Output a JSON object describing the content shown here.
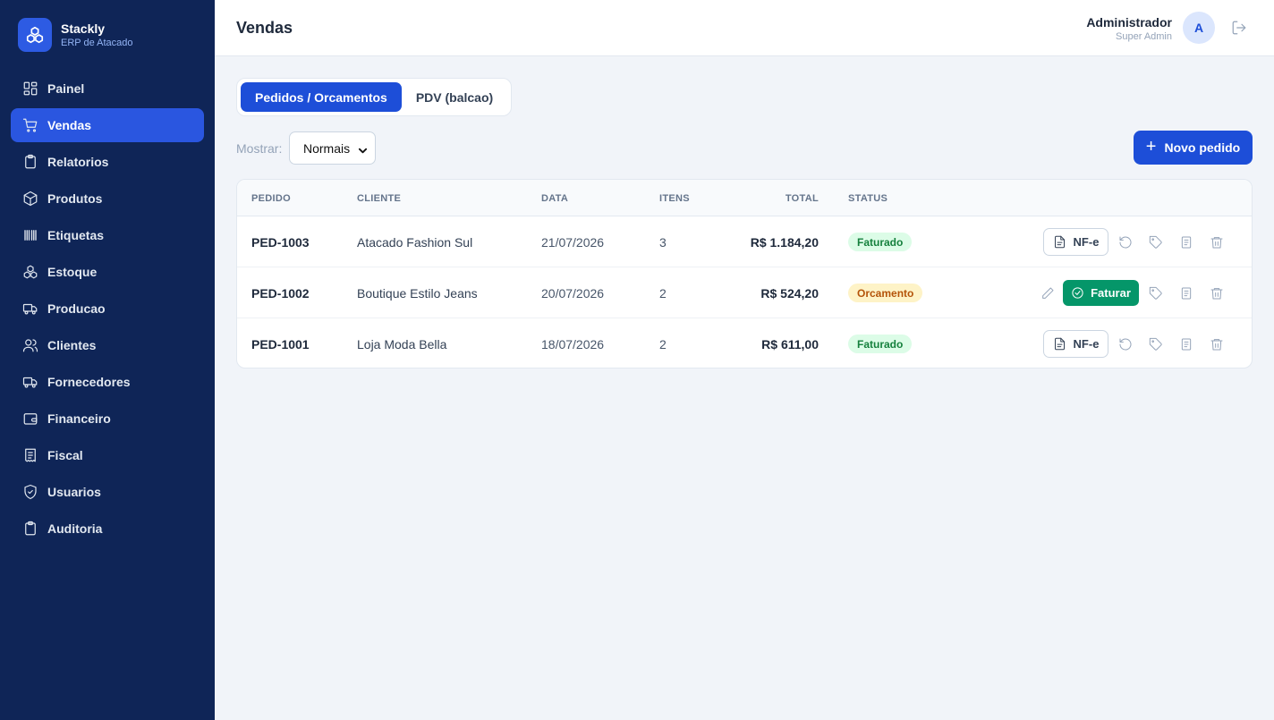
{
  "brand": {
    "name": "Stackly",
    "subtitle": "ERP de Atacado",
    "color": "#2d5be3"
  },
  "sidebar": {
    "items": [
      {
        "label": "Painel",
        "icon": "dashboard-icon"
      },
      {
        "label": "Vendas",
        "icon": "cart-icon",
        "active": true
      },
      {
        "label": "Relatorios",
        "icon": "clipboard-icon"
      },
      {
        "label": "Produtos",
        "icon": "box-icon"
      },
      {
        "label": "Etiquetas",
        "icon": "barcode-icon"
      },
      {
        "label": "Estoque",
        "icon": "boxes-icon"
      },
      {
        "label": "Producao",
        "icon": "truck-icon"
      },
      {
        "label": "Clientes",
        "icon": "users-icon"
      },
      {
        "label": "Fornecedores",
        "icon": "truck-icon"
      },
      {
        "label": "Financeiro",
        "icon": "wallet-icon"
      },
      {
        "label": "Fiscal",
        "icon": "receipt-icon"
      },
      {
        "label": "Usuarios",
        "icon": "shield-icon"
      },
      {
        "label": "Auditoria",
        "icon": "clipboard-icon"
      }
    ]
  },
  "header": {
    "title": "Vendas",
    "user_name": "Administrador",
    "user_role": "Super Admin",
    "avatar_initial": "A"
  },
  "tabs": [
    {
      "label": "Pedidos / Orcamentos",
      "active": true
    },
    {
      "label": "PDV (balcao)",
      "active": false
    }
  ],
  "filter": {
    "label": "Mostrar:",
    "value": "Normais"
  },
  "new_button": {
    "label": "Novo pedido"
  },
  "table": {
    "columns": [
      "PEDIDO",
      "CLIENTE",
      "DATA",
      "ITENS",
      "TOTAL",
      "STATUS"
    ],
    "rows": [
      {
        "id": "PED-1003",
        "cliente": "Atacado Fashion Sul",
        "data": "21/07/2026",
        "itens": "3",
        "total": "R$ 1.184,20",
        "status": "Faturado",
        "status_type": "faturado"
      },
      {
        "id": "PED-1002",
        "cliente": "Boutique Estilo Jeans",
        "data": "20/07/2026",
        "itens": "2",
        "total": "R$ 524,20",
        "status": "Orcamento",
        "status_type": "orcamento"
      },
      {
        "id": "PED-1001",
        "cliente": "Loja Moda Bella",
        "data": "18/07/2026",
        "itens": "2",
        "total": "R$ 611,00",
        "status": "Faturado",
        "status_type": "faturado"
      }
    ],
    "actions": {
      "nfe_label": "NF-e",
      "faturar_label": "Faturar"
    }
  },
  "colors": {
    "sidebar_bg": "#0f2557",
    "accent": "#1d4ed8",
    "success": "#059669"
  }
}
